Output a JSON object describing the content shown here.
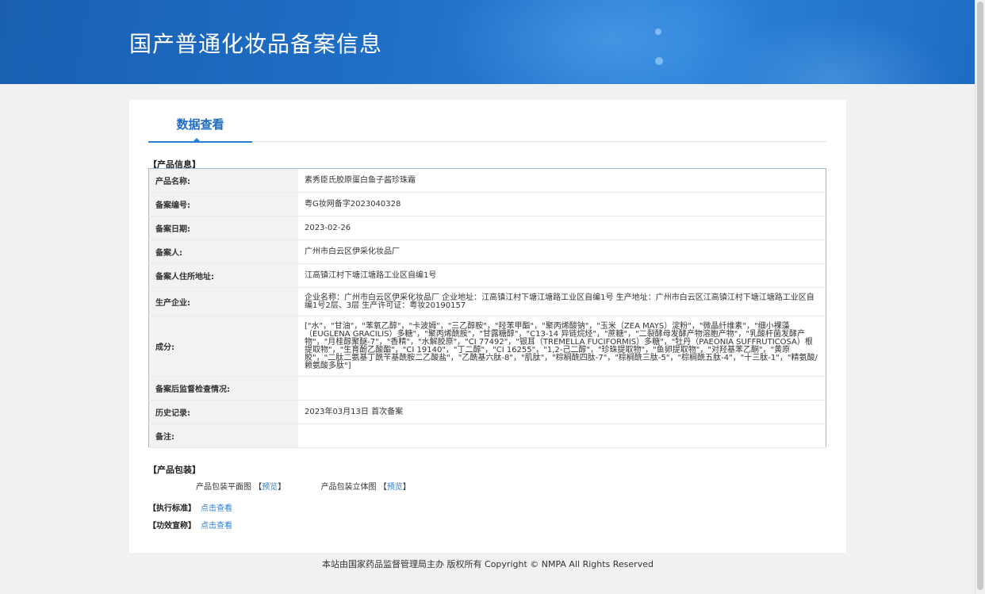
{
  "header": {
    "title": "国产普通化妆品备案信息"
  },
  "tabs": [
    {
      "label": "数据查看",
      "active": true
    }
  ],
  "product_info": {
    "section_title": "【产品信息】",
    "rows": [
      {
        "label": "产品名称:",
        "value": "素秀臣氏胶原蛋白鱼子酱珍珠霜"
      },
      {
        "label": "备案编号:",
        "value": "粤G妆网备字2023040328"
      },
      {
        "label": "备案日期:",
        "value": "2023-02-26"
      },
      {
        "label": "备案人:",
        "value": "广州市白云区伊采化妆品厂"
      },
      {
        "label": "备案人住所地址:",
        "value": "江高镇江村下塘江塘路工业区自编1号"
      },
      {
        "label": "生产企业:",
        "value": "企业名称：广州市白云区伊采化妆品厂 企业地址：江高镇江村下塘江塘路工业区自编1号 生产地址：广州市白云区江高镇江村下塘江塘路工业区自编1号2层、3层 生产许可证：粤妆20190157"
      },
      {
        "label": "成分:",
        "value": "[\"水\"，\"甘油\"，\"苯氧乙醇\"，\"卡波姆\"，\"三乙醇胺\"，\"羟苯甲酯\"，\"聚丙烯酸钠\"，\"玉米（ZEA MAYS）淀粉\"，\"微晶纤维素\"，\"细小裸藻（EUGLENA GRACILIS）多糖\"，\"聚丙烯酰胺\"，\"甘露糖醇\"，\"C13-14 异链烷烃\"，\"蔗糖\"，\"二裂酵母发酵产物溶胞产物\"，\"乳酸杆菌发酵产物\"，\"月桂醇聚醚-7\"，\"香精\"，\"水解胶原\"，\"CI 77492\"，\"银耳（TREMELLA FUCIFORMIS）多糖\"，\"牡丹（PAEONIA SUFFRUTICOSA）根提取物\"，\"生育酚乙酸酯\"，\"CI 19140\"，\"丁二醇\"，\"CI 16255\"，\"1,2-己二醇\"，\"珍珠提取物\"，\"鱼卵提取物\"，\"对羟基苯乙酮\"，\"黄原胶\"，\"二肽二氨基丁酰苄基酰胺二乙酸盐\"，\"乙酰基六肽-8\"，\"肌肽\"，\"棕榈酰四肽-7\"，\"棕榈酰三肽-5\"，\"棕榈酰五肽-4\"，\"十三肽-1\"，\"精氨酸/赖氨酸多肽\"]"
      },
      {
        "label": "备案后监督检查情况:",
        "value": ""
      },
      {
        "label": "历史记录:",
        "value": "2023年03月13日 首次备案"
      },
      {
        "label": "备注:",
        "value": ""
      }
    ]
  },
  "packaging": {
    "section_title": "【产品包装】",
    "flat_label": "产品包装平面图",
    "stereo_label": "产品包装立体图",
    "preview_link": "预览",
    "bracket_open": "【",
    "bracket_close": "】"
  },
  "standard": {
    "label": "【执行标准】",
    "link": "点击查看"
  },
  "efficacy": {
    "label": "【功效宣称】",
    "link": "点击查看"
  },
  "footer": {
    "text": "本站由国家药品监督管理局主办 版权所有 Copyright © NMPA All Rights Reserved"
  }
}
